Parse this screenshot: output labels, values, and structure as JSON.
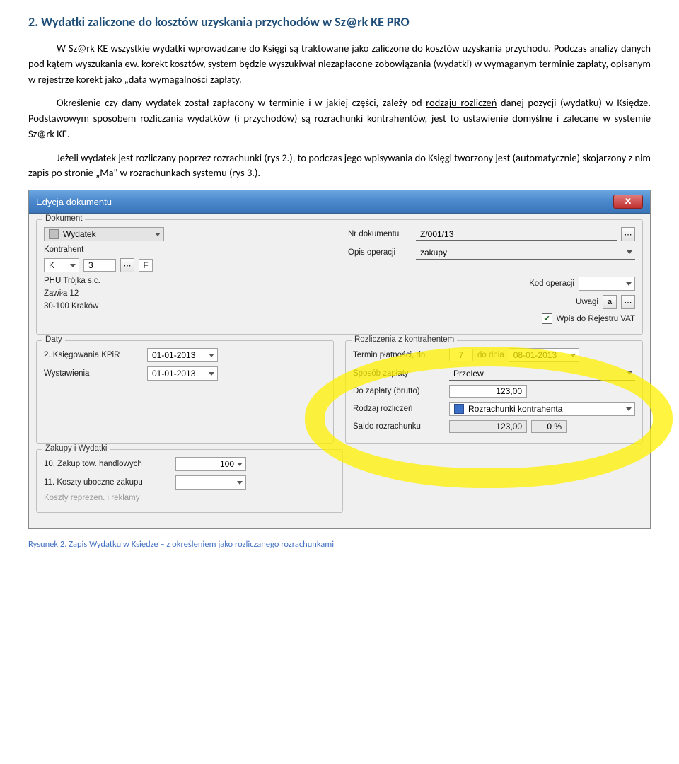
{
  "heading": "2. Wydatki zaliczone do kosztów uzyskania przychodów w Sz@rk KE PRO",
  "para1": "W Sz@rk KE wszystkie wydatki wprowadzane do Księgi są traktowane jako zaliczone do kosztów uzyskania przychodu. Podczas analizy danych pod kątem wyszukania ew. korekt kosztów, system będzie wyszukiwał niezapłacone zobowiązania (wydatki) w wymaganym terminie zapłaty, opisanym w rejestrze korekt jako „data wymagalności zapłaty.",
  "para2a": "Określenie czy dany wydatek został zapłacony w terminie i w jakiej części,  zależy od ",
  "para2u": "rodzaju rozliczeń",
  "para2b": " danej pozycji (wydatku) w Księdze. Podstawowym sposobem rozliczania wydatków (i  przychodów) są rozrachunki kontrahentów,   jest to ustawienie domyślne i zalecane w systemie Sz@rk KE.",
  "para3": "Jeżeli wydatek jest rozliczany poprzez rozrachunki (rys 2.), to podczas jego wpisywania do Księgi tworzony jest (automatycznie) skojarzony z nim zapis po stronie „Ma\" w rozrachunkach systemu (rys 3.).",
  "dlg": {
    "title": "Edycja dokumentu",
    "g_dokument": "Dokument",
    "wyd": "Wydatek",
    "kontrahent_lbl": "Kontrahent",
    "k_k": "K",
    "k_3": "3",
    "k_f": "F",
    "firma": "PHU Trójka s.c.",
    "ulica": "Zawiła 12",
    "miasto": "30-100 Kraków",
    "nrdok_lbl": "Nr dokumentu",
    "nrdok": "Z/001/13",
    "opis_lbl": "Opis operacji",
    "opis": "zakupy",
    "kod_lbl": "Kod operacji",
    "uwagi_lbl": "Uwagi",
    "uwagi_icon": "a",
    "wpis_lbl": "Wpis do Rejestru VAT",
    "g_daty": "Daty",
    "ksieg_lbl": "2. Księgowania KPiR",
    "ksieg_v": "01-01-2013",
    "wyst_lbl": "Wystawienia",
    "wyst_v": "01-01-2013",
    "g_rozl": "Rozliczenia z kontrahentem",
    "term_lbl": "Termin płatności, dni",
    "term_dni": "7",
    "term_do_lbl": "do dnia",
    "term_do": "08-01-2013",
    "spos_lbl": "Sposób zapłaty",
    "spos_v": "Przelew",
    "dozap_lbl": "Do zapłaty (brutto)",
    "dozap_v": "123,00",
    "rodzaj_lbl": "Rodzaj rozliczeń",
    "rodzaj_v": "Rozrachunki kontrahenta",
    "saldo_lbl": "Saldo rozrachunku",
    "saldo_v": "123,00",
    "saldo_pct": "0 %",
    "g_zakupy": "Zakupy i Wydatki",
    "z10_lbl": "10. Zakup tow. handlowych",
    "z10_v": "100",
    "z11_lbl": "11. Koszty uboczne zakupu",
    "reprez_lbl": "Koszty reprezen. i reklamy"
  },
  "caption": "Rysunek 2. Zapis Wydatku w Księdze – z określeniem jako rozliczanego rozrachunkami"
}
